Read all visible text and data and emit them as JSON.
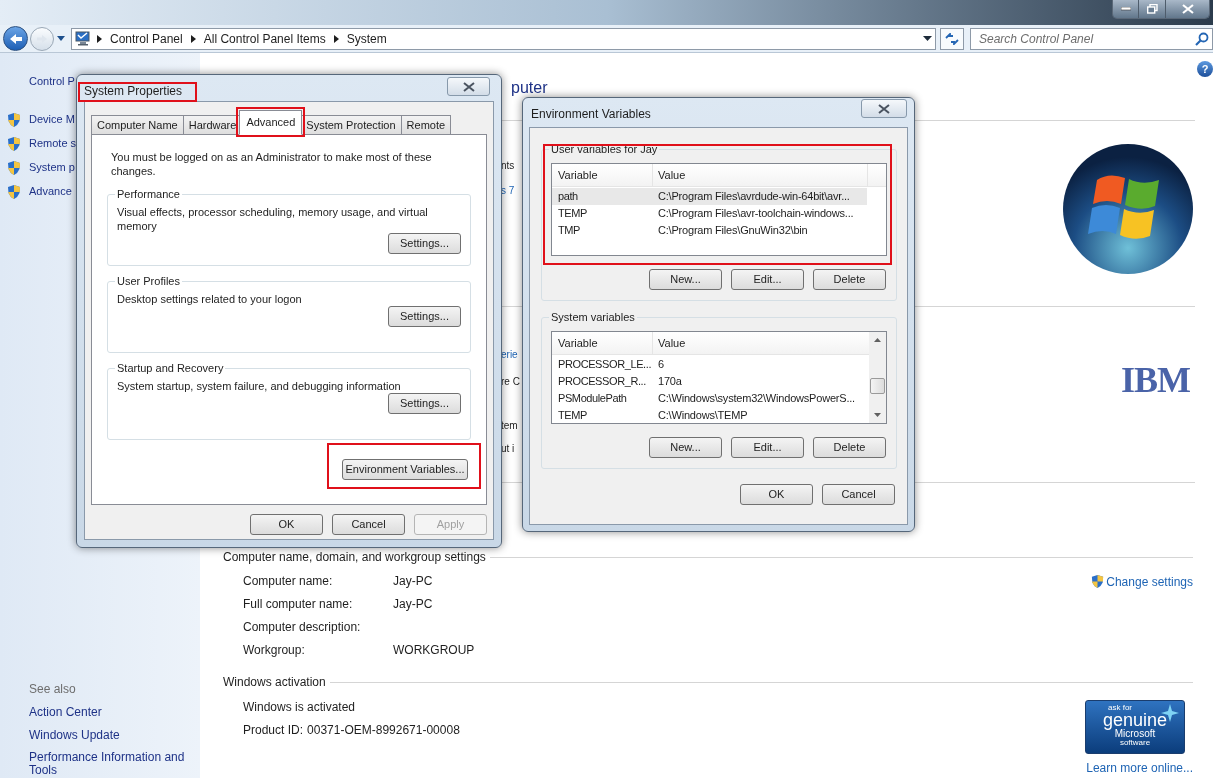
{
  "address_bar": {
    "breadcrumbs": [
      "Control Panel",
      "All Control Panel Items",
      "System"
    ]
  },
  "search": {
    "placeholder": "Search Control Panel"
  },
  "help_button": "?",
  "sidebar": {
    "home_link": "Control P",
    "tasks": [
      "Device M",
      "Remote s",
      "System p",
      "Advance"
    ],
    "see_also_title": "See also",
    "see_also": [
      "Action Center",
      "Windows Update",
      "Performance Information and Tools"
    ]
  },
  "main": {
    "heading": "puter",
    "fragments": [
      {
        "text": "nts",
        "kind": "text"
      },
      {
        "text": "s 7",
        "kind": "link"
      },
      {
        "text": "erie",
        "kind": "link"
      },
      {
        "text": "re C",
        "kind": "text"
      },
      {
        "text": "tem",
        "kind": "text"
      },
      {
        "text": "ut i",
        "kind": "text"
      }
    ],
    "oem_logo": "IBM",
    "computer_section": {
      "title": "Computer name, domain, and workgroup settings",
      "rows": [
        {
          "label": "Computer name:",
          "value": "Jay-PC"
        },
        {
          "label": "Full computer name:",
          "value": "Jay-PC"
        },
        {
          "label": "Computer description:"
        },
        {
          "label": "Workgroup:",
          "value": "WORKGROUP"
        }
      ],
      "change_settings": "Change settings"
    },
    "activation_section": {
      "title": "Windows activation",
      "status": "Windows is activated",
      "product_id_label": "Product ID:",
      "product_id": "00371-OEM-8992671-00008",
      "genuine_badge": [
        "ask for",
        "genuine",
        "Microsoft",
        "software"
      ],
      "learn_more": "Learn more online..."
    }
  },
  "system_properties": {
    "title": "System Properties",
    "title_highlighted": true,
    "tabs": [
      {
        "label": "Computer Name",
        "selected": false,
        "highlighted": false
      },
      {
        "label": "Hardware",
        "selected": false,
        "highlighted": false
      },
      {
        "label": "Advanced",
        "selected": true,
        "highlighted": true
      },
      {
        "label": "System Protection",
        "selected": false,
        "highlighted": false
      },
      {
        "label": "Remote",
        "selected": false,
        "highlighted": false
      }
    ],
    "admin_note": "You must be logged on as an Administrator to make most of these changes.",
    "groups": [
      {
        "title": "Performance",
        "description": "Visual effects, processor scheduling, memory usage, and virtual memory",
        "button": "Settings..."
      },
      {
        "title": "User Profiles",
        "description": "Desktop settings related to your logon",
        "button": "Settings..."
      },
      {
        "title": "Startup and Recovery",
        "description": "System startup, system failure, and debugging information",
        "button": "Settings..."
      }
    ],
    "env_button": {
      "label": "Environment Variables...",
      "highlighted": true
    },
    "buttons": [
      {
        "label": "OK",
        "disabled": false
      },
      {
        "label": "Cancel",
        "disabled": false
      },
      {
        "label": "Apply",
        "disabled": true
      }
    ]
  },
  "environment_variables": {
    "title": "Environment Variables",
    "groups": [
      {
        "title": "User variables for Jay",
        "highlighted": true,
        "scrollable": false,
        "columns": [
          "Variable",
          "Value"
        ],
        "rows": [
          {
            "variable": "path",
            "value": "C:\\Program Files\\avrdude-win-64bit\\avr...",
            "selected": true
          },
          {
            "variable": "TEMP",
            "value": "C:\\Program Files\\avr-toolchain-windows...",
            "selected": false
          },
          {
            "variable": "TMP",
            "value": "C:\\Program Files\\GnuWin32\\bin",
            "selected": false
          }
        ],
        "buttons": [
          "New...",
          "Edit...",
          "Delete"
        ]
      },
      {
        "title": "System variables",
        "highlighted": false,
        "scrollable": true,
        "columns": [
          "Variable",
          "Value"
        ],
        "rows": [
          {
            "variable": "PROCESSOR_LE...",
            "value": "6",
            "selected": false
          },
          {
            "variable": "PROCESSOR_R...",
            "value": "170a",
            "selected": false
          },
          {
            "variable": "PSModulePath",
            "value": "C:\\Windows\\system32\\WindowsPowerS...",
            "selected": false
          },
          {
            "variable": "TEMP",
            "value": "C:\\Windows\\TEMP",
            "selected": false
          }
        ],
        "buttons": [
          "New...",
          "Edit...",
          "Delete"
        ]
      }
    ],
    "buttons": [
      "OK",
      "Cancel"
    ]
  }
}
